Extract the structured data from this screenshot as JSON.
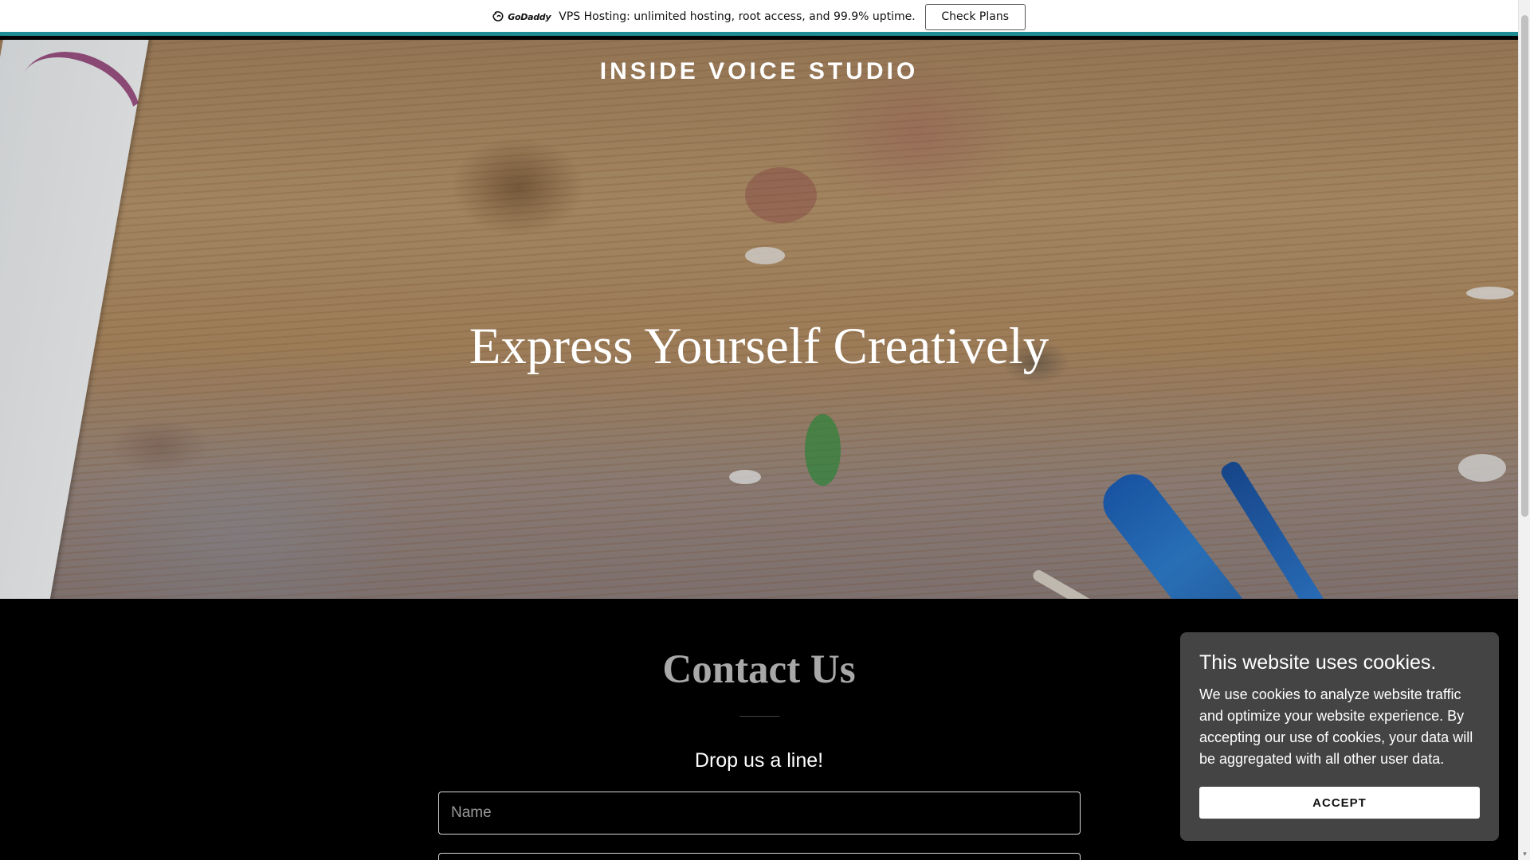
{
  "promo": {
    "logo_text": "GoDaddy",
    "message": "VPS Hosting: unlimited hosting, root access, and 99.9% uptime.",
    "button_label": "Check Plans",
    "accent_color": "#1e8c95"
  },
  "hero": {
    "site_title": "INSIDE VOICE STUDIO",
    "heading": "Express Yourself Creatively"
  },
  "contact": {
    "title": "Contact Us",
    "subtitle": "Drop us a line!",
    "name_placeholder": "Name"
  },
  "cookie_banner": {
    "title": "This website uses cookies.",
    "body": "We use cookies to analyze website traffic and optimize your website experience. By accepting our use of cookies, your data will be aggregated with all other user data.",
    "accept_label": "ACCEPT",
    "background_color": "#444444"
  },
  "icons": {
    "logo": "godaddy-logo-icon",
    "scroll_down": "chevron-down-icon"
  }
}
